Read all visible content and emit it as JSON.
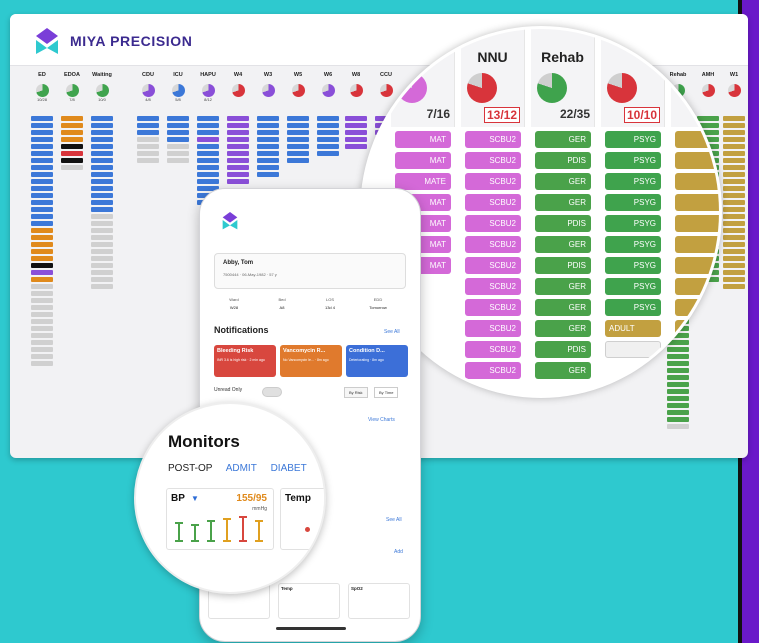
{
  "brand": {
    "name": "MIYA PRECISION",
    "logo_colors": [
      "#7a3ed8",
      "#2ec9cf"
    ]
  },
  "colors": {
    "teal_background": "#2ec9cf",
    "purple_stripe": "#6a19c9"
  },
  "board": {
    "columns": [
      {
        "name": "ED",
        "pie": "green",
        "count": "10/28"
      },
      {
        "name": "EDOA",
        "pie": "green",
        "count": "7/8"
      },
      {
        "name": "Waiting",
        "pie": "green",
        "count": "10/0"
      },
      {
        "name": "CDU",
        "pie": "purple",
        "count": "4/8"
      },
      {
        "name": "ICU",
        "pie": "blue",
        "count": "5/8"
      },
      {
        "name": "HAPU",
        "pie": "purple",
        "count": "8/12"
      },
      {
        "name": "W4",
        "pie": "red",
        "count": ""
      },
      {
        "name": "W3",
        "pie": "purple",
        "count": ""
      },
      {
        "name": "W5",
        "pie": "red",
        "count": ""
      },
      {
        "name": "W6",
        "pie": "purple",
        "count": ""
      },
      {
        "name": "W8",
        "pie": "red",
        "count": ""
      },
      {
        "name": "CCU",
        "pie": "red",
        "count": ""
      }
    ],
    "right_columns": [
      {
        "name": "Rehab",
        "pie": "green"
      },
      {
        "name": "AMH",
        "pie": "red"
      },
      {
        "name": "W1",
        "pie": "red"
      }
    ]
  },
  "magnifier": {
    "columns": [
      {
        "name": "",
        "count": "7/16",
        "chips": [
          "MAT",
          "MAT",
          "MATE",
          "MAT",
          "MAT",
          "MAT",
          "MAT"
        ]
      },
      {
        "name": "NNU",
        "count": "13/12",
        "count_red": true,
        "chips": [
          "SCBU2",
          "SCBU2",
          "SCBU2",
          "SCBU2",
          "SCBU2",
          "SCBU2",
          "SCBU2",
          "SCBU2",
          "SCBU2",
          "SCBU2",
          "SCBU2",
          "SCBU2"
        ]
      },
      {
        "name": "Rehab",
        "count": "22/35",
        "chips": [
          "GER",
          "PDIS",
          "GER",
          "GER",
          "PDIS",
          "GER",
          "PDIS",
          "GER",
          "GER",
          "GER",
          "PDIS",
          "GER"
        ]
      },
      {
        "name": "",
        "count": "10/10",
        "count_red": true,
        "chips": [
          "PSYG",
          "PSYG",
          "PSYG",
          "PSYG",
          "PSYG",
          "PSYG",
          "PSYG",
          "PSYG",
          "PSYG",
          "ADULT",
          ""
        ]
      },
      {
        "name": "",
        "count": "",
        "chips": [
          "",
          "A",
          "",
          "A",
          "",
          "A",
          "",
          "",
          "",
          "",
          ""
        ]
      }
    ]
  },
  "phone": {
    "patient_name": "Abby, Tom",
    "patient_sub": "7500444 · 06-May-1982 · 57 y",
    "meta": [
      "Ward",
      "Bed",
      "LOS",
      "EDD"
    ],
    "meta_values": [
      "W28",
      "A8",
      "13d 4",
      "Tomorrow"
    ],
    "notifications_title": "Notifications",
    "see_all": "See All",
    "notifications": [
      {
        "title": "Bleeding Risk",
        "sub": "INR 3.6 is high risk · 2 min ago",
        "color": "#d8473e"
      },
      {
        "title": "Vancomycin R...",
        "sub": "No Vancomycin le... · 8m ago",
        "color": "#e07a2d"
      },
      {
        "title": "Condition D...",
        "sub": "Deteriorating · 8m ago",
        "color": "#3c6fd8"
      }
    ],
    "unread_only": "Unread Only",
    "by_risk": "By Risk",
    "by_time": "By Time",
    "view_charts": "View Charts",
    "add": "Add",
    "mini_cards": [
      "BP",
      "Temp",
      "SpO2"
    ]
  },
  "monitors": {
    "title": "Monitors",
    "tabs": [
      "POST-OP",
      "ADMIT",
      "DIABET"
    ],
    "bp_label": "BP",
    "bp_value": "155/95",
    "bp_unit": "mmHg",
    "temp_label": "Temp"
  }
}
